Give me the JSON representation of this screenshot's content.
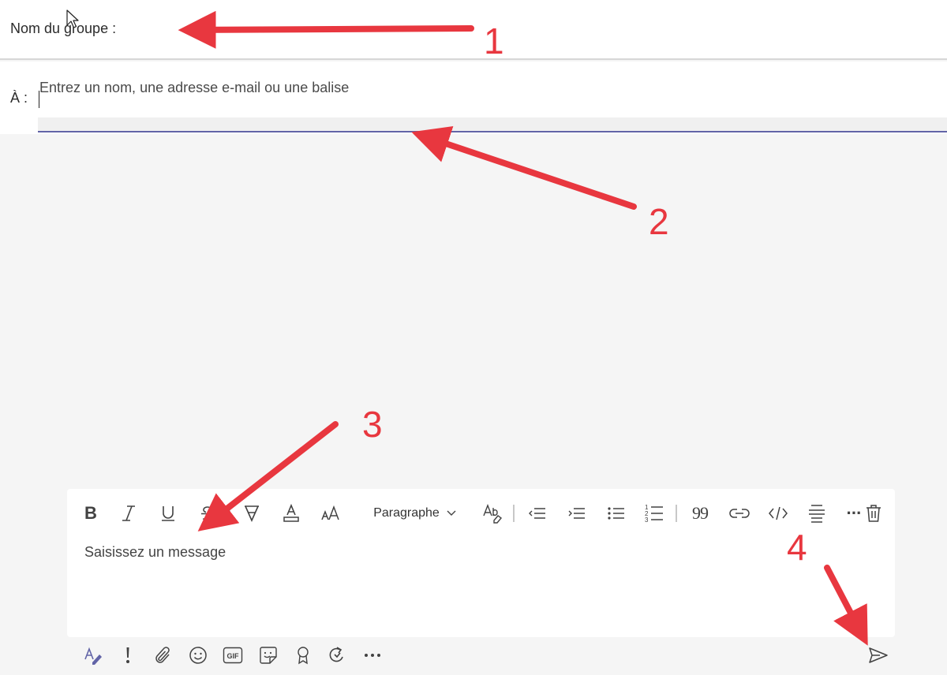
{
  "header": {
    "group_name_label": "Nom du groupe :",
    "to_label": "À :",
    "to_placeholder": "Entrez un nom, une adresse e-mail ou une balise"
  },
  "compose": {
    "toolbar": {
      "bold_glyph": "B",
      "paragraph_label": "Paragraphe",
      "quote_glyph": "99",
      "more_glyph": "···"
    },
    "message_placeholder": "Saisissez un message"
  },
  "bottom_bar": {
    "icons": [
      "format-icon",
      "important-icon",
      "attach-icon",
      "emoji-icon",
      "gif-icon",
      "sticker-icon",
      "praise-icon",
      "loop-icon",
      "more-icon",
      "send-icon"
    ],
    "gif_text": "GIF"
  },
  "annotations": {
    "labels": [
      "1",
      "2",
      "3",
      "4"
    ],
    "color": "#e8373f"
  },
  "colors": {
    "accent": "#6264a7",
    "annotation": "#e8373f",
    "background": "#f5f5f5"
  }
}
